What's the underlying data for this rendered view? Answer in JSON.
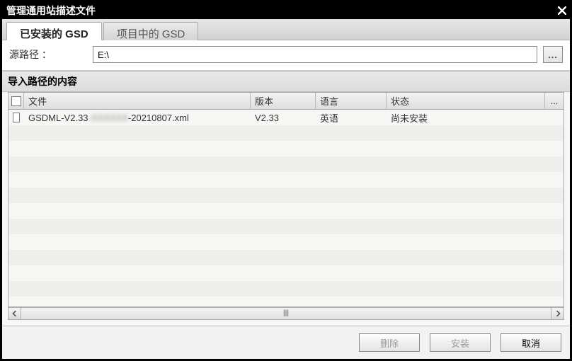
{
  "window": {
    "title": "管理通用站描述文件"
  },
  "tabs": {
    "installed": "已安装的 GSD",
    "in_project": "项目中的 GSD",
    "active": "installed"
  },
  "source": {
    "label": "源路径 ：",
    "value": "E:\\",
    "browse_label": "..."
  },
  "section": {
    "title": "导入路径的内容"
  },
  "table": {
    "headers": {
      "file": "文件",
      "version": "版本",
      "language": "语言",
      "status": "状态",
      "more": "..."
    },
    "rows": [
      {
        "checked": false,
        "file_prefix": "GSDML-V2.33",
        "file_obscured": "-XXXXXX",
        "file_suffix": "-20210807.xml",
        "version": "V2.33",
        "language": "英语",
        "status": "尚未安装"
      }
    ]
  },
  "buttons": {
    "delete": "删除",
    "install": "安装",
    "cancel": "取消"
  }
}
